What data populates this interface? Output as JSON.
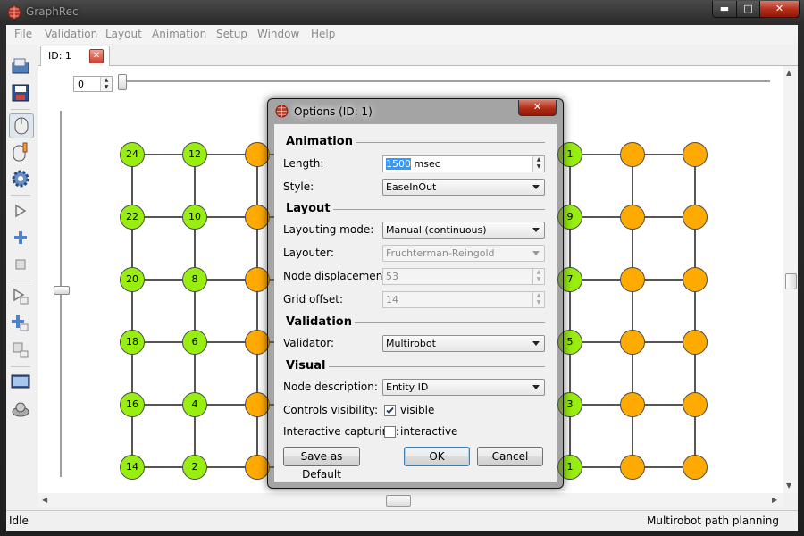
{
  "app": {
    "title": "GraphRec"
  },
  "window_buttons": {
    "minimize": "▬",
    "maximize": "□",
    "close": "✕"
  },
  "menu": [
    "File",
    "Validation",
    "Layout",
    "Animation",
    "Setup",
    "Window",
    "Help"
  ],
  "toolbar": [
    "open-icon",
    "save-icon",
    "mouse-pointer-icon",
    "mouse-edit-icon",
    "settings-gear-icon",
    "play-icon",
    "add-icon",
    "stop-icon",
    "play-record-icon",
    "add-record-icon",
    "stop-record-icon",
    "screenshot-icon",
    "capture-icon"
  ],
  "tab": {
    "label": "ID: 1",
    "close": "✕"
  },
  "frame_spinner": {
    "value": "0"
  },
  "graph": {
    "left_column_a": [
      "24",
      "22",
      "20",
      "18",
      "16",
      "14"
    ],
    "left_column_b": [
      "12",
      "10",
      "8",
      "6",
      "4",
      "2"
    ],
    "right_hidden_labels": [
      "1",
      "9",
      "7",
      "5",
      "3",
      "1"
    ]
  },
  "status": {
    "left": "Idle",
    "right": "Multirobot path planning"
  },
  "dialog": {
    "title": "Options (ID: 1)",
    "close": "✕",
    "sections": {
      "animation": "Animation",
      "layout": "Layout",
      "validation": "Validation",
      "visual": "Visual"
    },
    "labels": {
      "length": "Length:",
      "style": "Style:",
      "layouting_mode": "Layouting mode:",
      "layouter": "Layouter:",
      "node_displacement": "Node displacement:",
      "grid_offset": "Grid offset:",
      "validator": "Validator:",
      "node_description": "Node description:",
      "controls_visibility": "Controls visibility:",
      "interactive_capturing": "Interactive capturing:"
    },
    "values": {
      "length": "1500",
      "length_unit": " msec",
      "style": "EaseInOut",
      "layouting_mode": "Manual (continuous)",
      "layouter": "Fruchterman-Reingold",
      "node_displacement": "53",
      "grid_offset": "14",
      "validator": "Multirobot",
      "node_description": "Entity ID",
      "controls_visibility": "visible",
      "interactive_capturing": "interactive"
    },
    "checkbox_state": {
      "controls_visibility": true,
      "interactive_capturing": false
    },
    "buttons": {
      "save_default": "Save as Default",
      "ok": "OK",
      "cancel": "Cancel"
    }
  },
  "colors": {
    "node_green": "#99ee11",
    "node_orange": "#ffaa00",
    "close_red": "#b22b16"
  }
}
